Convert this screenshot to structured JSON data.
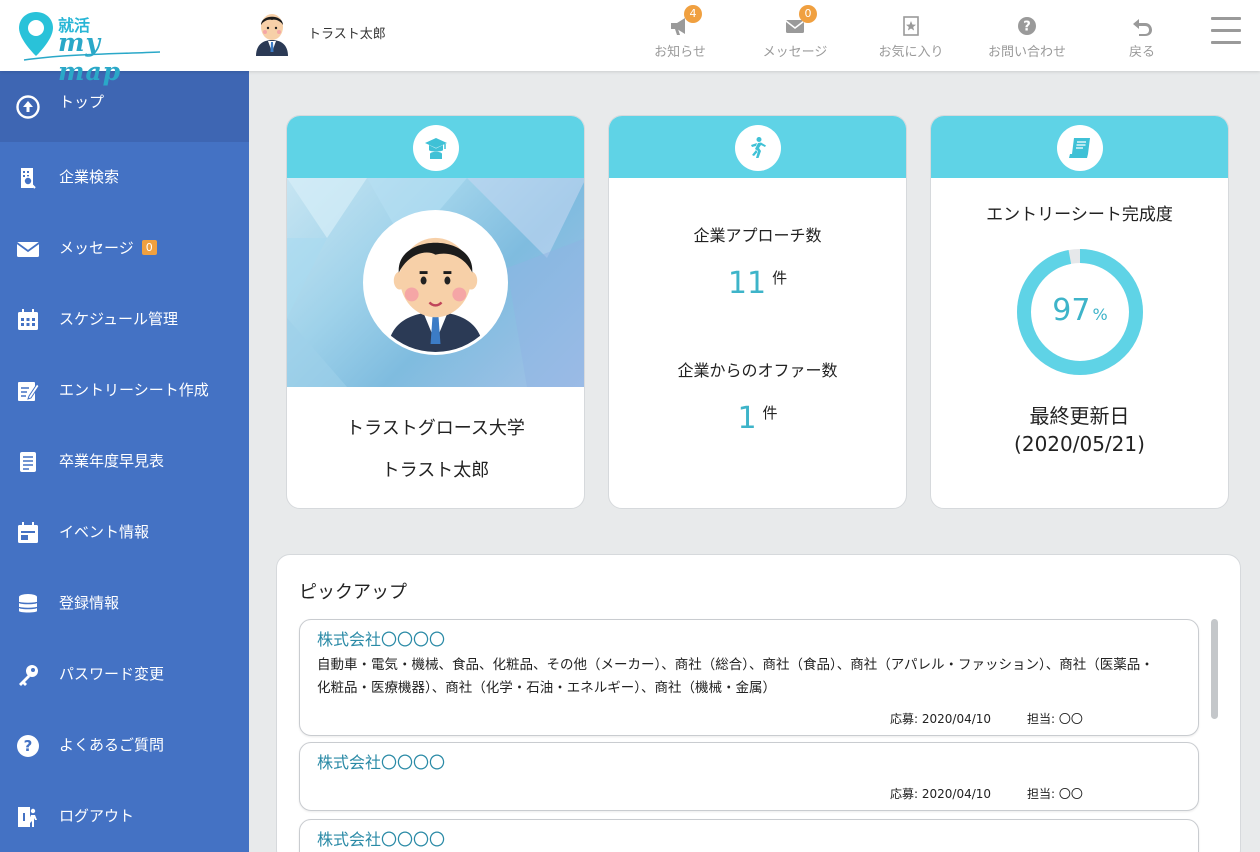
{
  "header": {
    "logo_jp": "就活",
    "logo_en": "my map",
    "user_name": "トラスト太郎",
    "nav": [
      {
        "label": "お知らせ",
        "badge": "4",
        "icon": "megaphone-icon"
      },
      {
        "label": "メッセージ",
        "badge": "0",
        "icon": "envelope-icon"
      },
      {
        "label": "お気に入り",
        "icon": "bookmark-star-icon"
      },
      {
        "label": "お問い合わせ",
        "icon": "question-icon"
      },
      {
        "label": "戻る",
        "icon": "back-arrow-icon"
      }
    ]
  },
  "sidebar": {
    "items": [
      {
        "label": "トップ",
        "icon": "up-arrow-circle-icon"
      },
      {
        "label": "企業検索",
        "icon": "building-search-icon"
      },
      {
        "label": "メッセージ",
        "badge": "0",
        "icon": "envelope-icon"
      },
      {
        "label": "スケジュール管理",
        "icon": "calendar-icon"
      },
      {
        "label": "エントリーシート作成",
        "icon": "edit-sheet-icon"
      },
      {
        "label": "卒業年度早見表",
        "icon": "document-list-icon"
      },
      {
        "label": "イベント情報",
        "icon": "event-calendar-icon"
      },
      {
        "label": "登録情報",
        "icon": "database-icon"
      },
      {
        "label": "パスワード変更",
        "icon": "key-icon"
      },
      {
        "label": "よくあるご質問",
        "icon": "question-icon"
      },
      {
        "label": "ログアウト",
        "icon": "logout-icon"
      }
    ]
  },
  "profile": {
    "university": "トラストグロース大学",
    "name": "トラスト太郎"
  },
  "stats": {
    "approach_label": "企業アプローチ数",
    "approach_value": "11",
    "offer_label": "企業からのオファー数",
    "offer_value": "1",
    "unit": "件"
  },
  "entry_sheet": {
    "label": "エントリーシート完成度",
    "percent": "97",
    "percent_symbol": "%",
    "updated_label": "最終更新日",
    "updated_date": "(2020/05/21)"
  },
  "pickup": {
    "title": "ピックアップ",
    "items": [
      {
        "company": "株式会社〇〇〇〇",
        "description": "自動車・電気・機械、食品、化粧品、その他（メーカー）、商社（総合）、商社（食品）、商社（アパレル・ファッション）、商社（医薬品・化粧品・医療機器）、商社（化学・石油・エネルギー）、商社（機械・金属）",
        "applied": "応募: 2020/04/10",
        "contact": "担当: 〇〇"
      },
      {
        "company": "株式会社〇〇〇〇",
        "description": "",
        "applied": "応募: 2020/04/10",
        "contact": "担当: 〇〇"
      },
      {
        "company": "株式会社〇〇〇〇",
        "description": "",
        "applied": "",
        "contact": ""
      }
    ]
  },
  "colors": {
    "sidebar": "#4472c4",
    "accent": "#5fd3e6",
    "badge": "#f0a040",
    "link": "#2a8aa6"
  }
}
